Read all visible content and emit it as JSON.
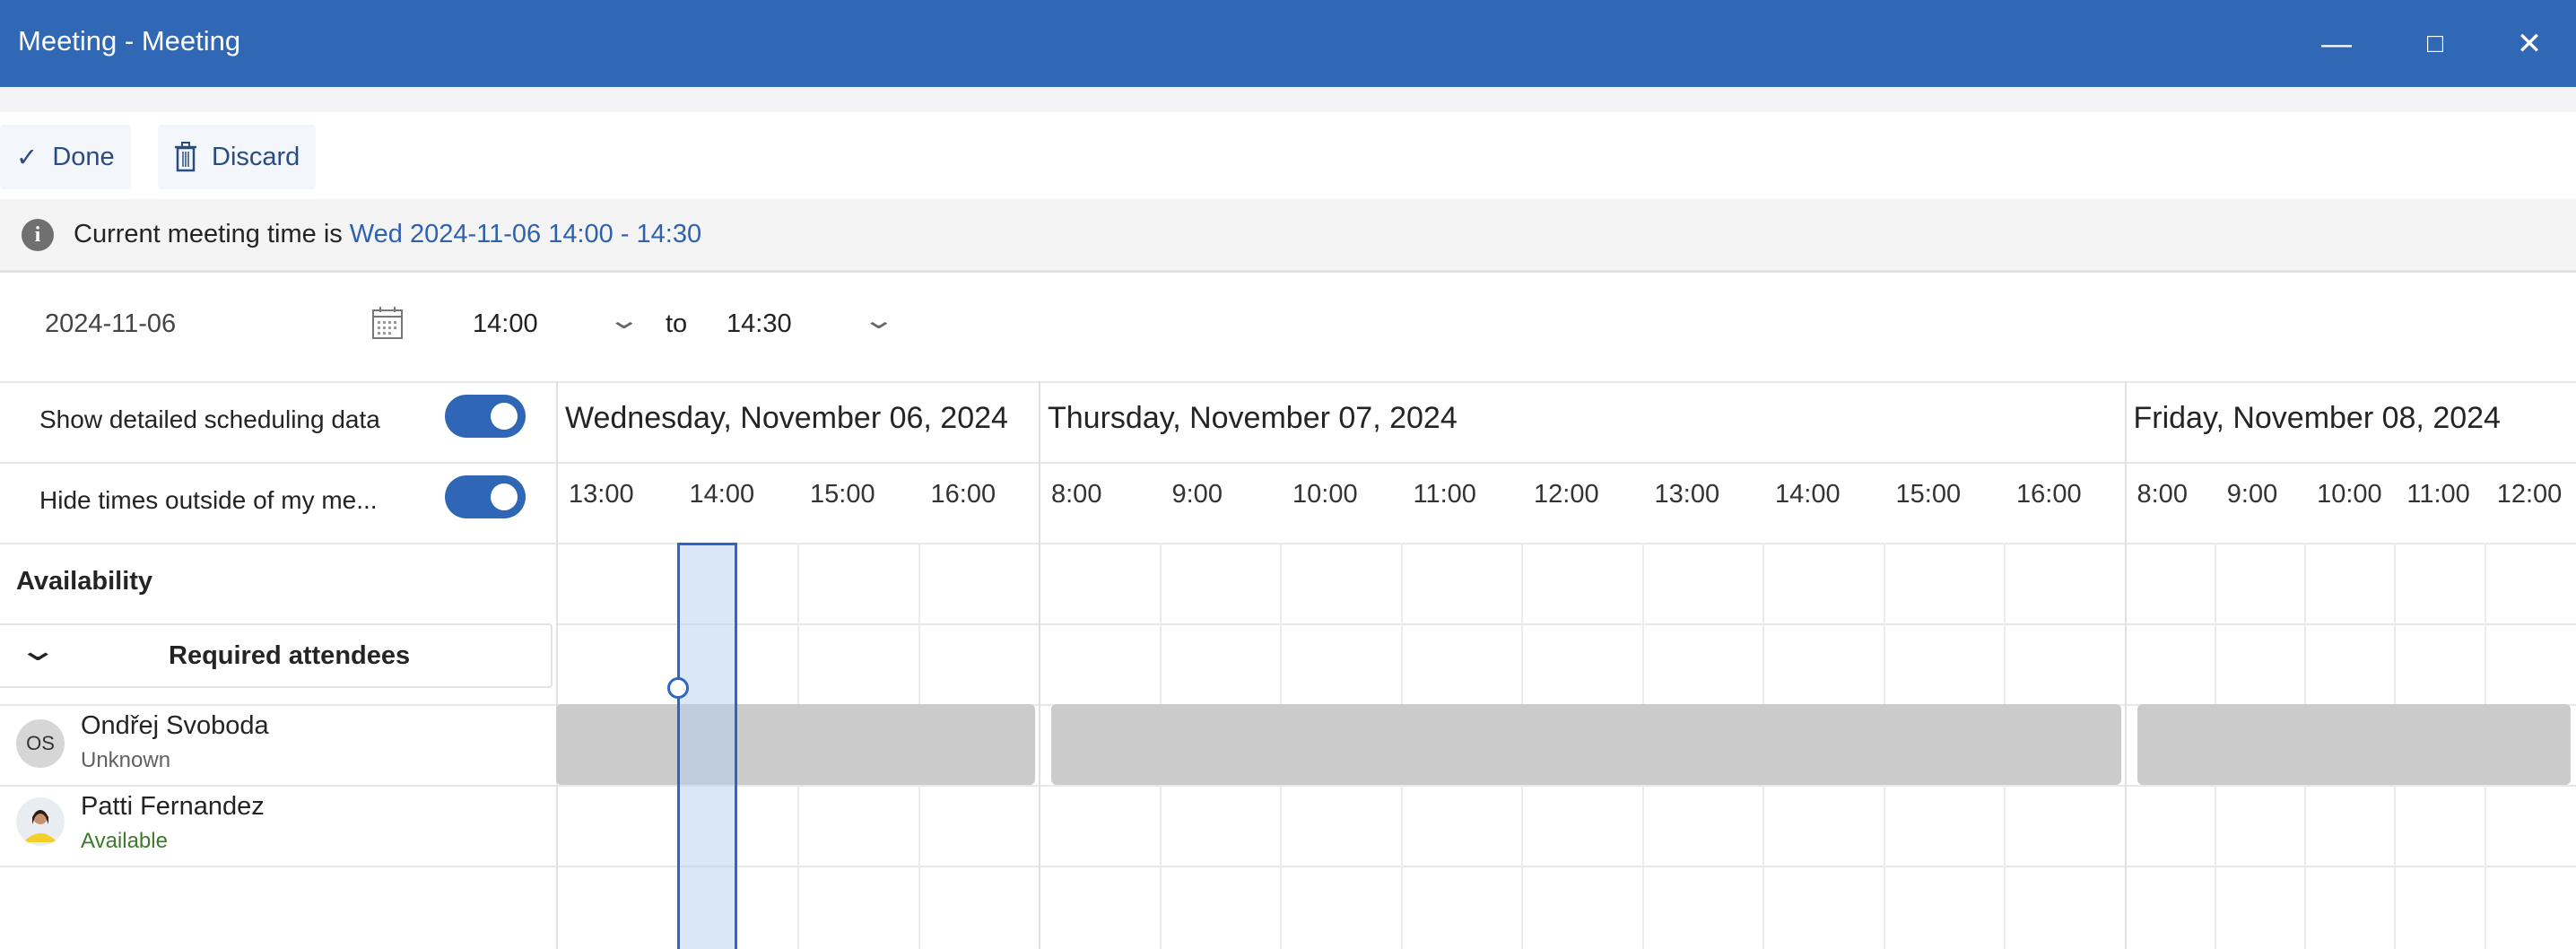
{
  "window": {
    "title": "Meeting - Meeting",
    "minimize_icon": "minimize-icon",
    "maximize_icon": "maximize-icon",
    "close_icon": "close-icon"
  },
  "toolbar": {
    "done_label": "Done",
    "discard_label": "Discard"
  },
  "info": {
    "prefix": "Current meeting time is",
    "time_link": "Wed 2024-11-06 14:00 - 14:30"
  },
  "time_picker": {
    "date": "2024-11-06",
    "start": "14:00",
    "to": "to",
    "end": "14:30"
  },
  "options": {
    "show_detailed": "Show detailed scheduling data",
    "show_detailed_on": true,
    "hide_outside": "Hide times outside of my me...",
    "hide_outside_on": true
  },
  "availability_label": "Availability",
  "group": {
    "label": "Required attendees"
  },
  "attendees": [
    {
      "initials": "OS",
      "name": "Ondřej Svoboda",
      "status": "Unknown",
      "status_color": "#616161"
    },
    {
      "initials": "",
      "name": "Patti Fernandez",
      "status": "Available",
      "status_color": "#3d7a2e"
    }
  ],
  "schedule": {
    "days": [
      {
        "label": "Wednesday, November 06, 2024",
        "hours": [
          "13:00",
          "14:00",
          "15:00",
          "16:00"
        ]
      },
      {
        "label": "Thursday, November 07, 2024",
        "hours": [
          "8:00",
          "9:00",
          "10:00",
          "11:00",
          "12:00",
          "13:00",
          "14:00",
          "15:00",
          "16:00"
        ]
      },
      {
        "label": "Friday, November 08, 2024",
        "hours": [
          "8:00",
          "9:00",
          "10:00",
          "11:00",
          "12:00"
        ]
      }
    ],
    "meeting": {
      "day": 0,
      "start": "14:00",
      "end": "14:30"
    },
    "accent": "#2f66c4"
  }
}
